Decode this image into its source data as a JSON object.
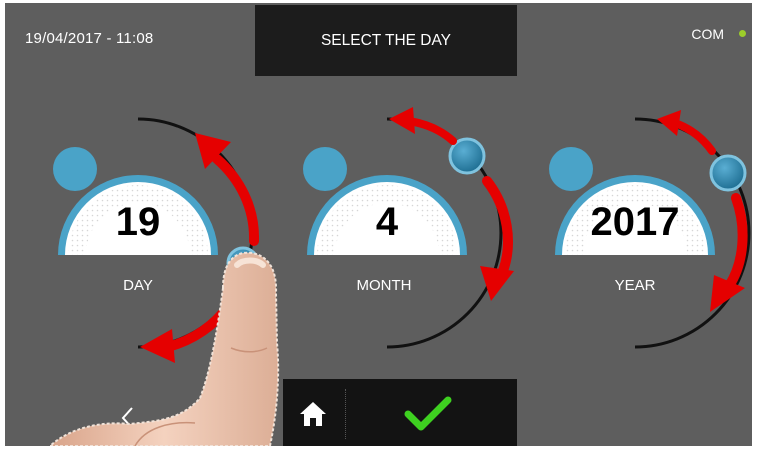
{
  "header": {
    "datetime": "19/04/2017 - 11:08",
    "title": "SELECT THE DAY",
    "status_label": "COM",
    "status_color": "#9ccd2a"
  },
  "dials": [
    {
      "label": "DAY",
      "value": "19"
    },
    {
      "label": "MONTH",
      "value": "4"
    },
    {
      "label": "YEAR",
      "value": "2017"
    }
  ],
  "bottom_bar": {
    "icons": [
      "back-icon",
      "home-icon",
      "confirm-check-icon"
    ]
  },
  "colors": {
    "background": "#5e5e5e",
    "panel": "#1c1c1c",
    "dial_ring": "#4aa3c8",
    "arrow": "#e50000",
    "check": "#3ed120"
  }
}
